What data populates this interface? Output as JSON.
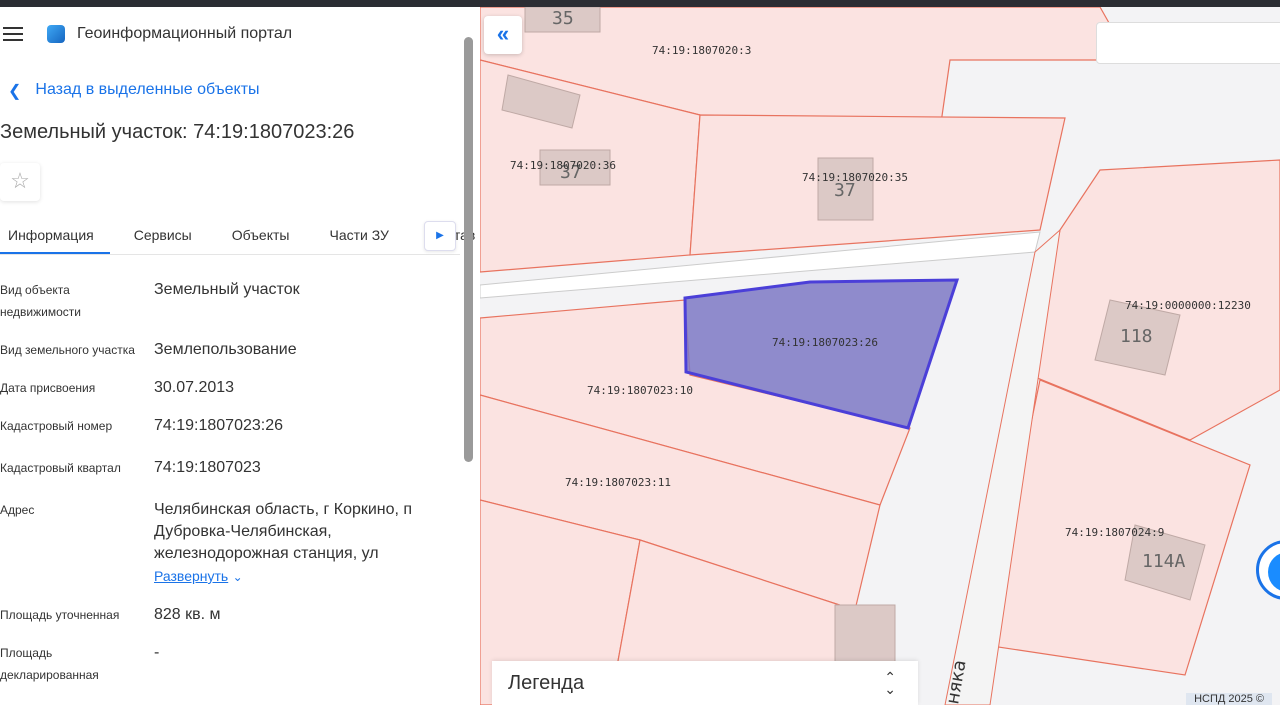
{
  "header": {
    "app_title": "Геоинформационный портал"
  },
  "back_link": "Назад в выделенные объекты",
  "title": "Земельный участок: 74:19:1807023:26",
  "tabs": [
    "Информация",
    "Сервисы",
    "Объекты",
    "Части ЗУ",
    "Состав"
  ],
  "fields": [
    {
      "k": "Вид объекта недвижимости",
      "v": "Земельный участок"
    },
    {
      "k": "Вид земельного участка",
      "v": "Землепользование"
    },
    {
      "k": "Дата присвоения",
      "v": "30.07.2013"
    },
    {
      "k": "Кадастровый номер",
      "v": "74:19:1807023:26"
    },
    {
      "k": "Кадастровый квартал",
      "v": "74:19:1807023"
    },
    {
      "k": "Адрес",
      "v": "Челябинская область, г Коркино, п Дубровка-Челябинская, железнодорожная станция, ул"
    },
    {
      "k": "Площадь уточненная",
      "v": "828 кв. м"
    },
    {
      "k": "Площадь декларированная",
      "v": "-"
    }
  ],
  "expand_label": "Развернуть",
  "map": {
    "parcel_labels": [
      "74:19:1807020:3",
      "74:19:1807020:36",
      "74:19:1807020:35",
      "74:19:1807023:26",
      "74:19:1807023:10",
      "74:19:1807023:11",
      "74:19:0000000:12230",
      "74:19:1807024:9"
    ],
    "building_labels": [
      "35",
      "37",
      "37",
      "118",
      "114А"
    ],
    "street_label": "няка",
    "legend": "Легенда",
    "attribution": "НСПД 2025 ©"
  }
}
